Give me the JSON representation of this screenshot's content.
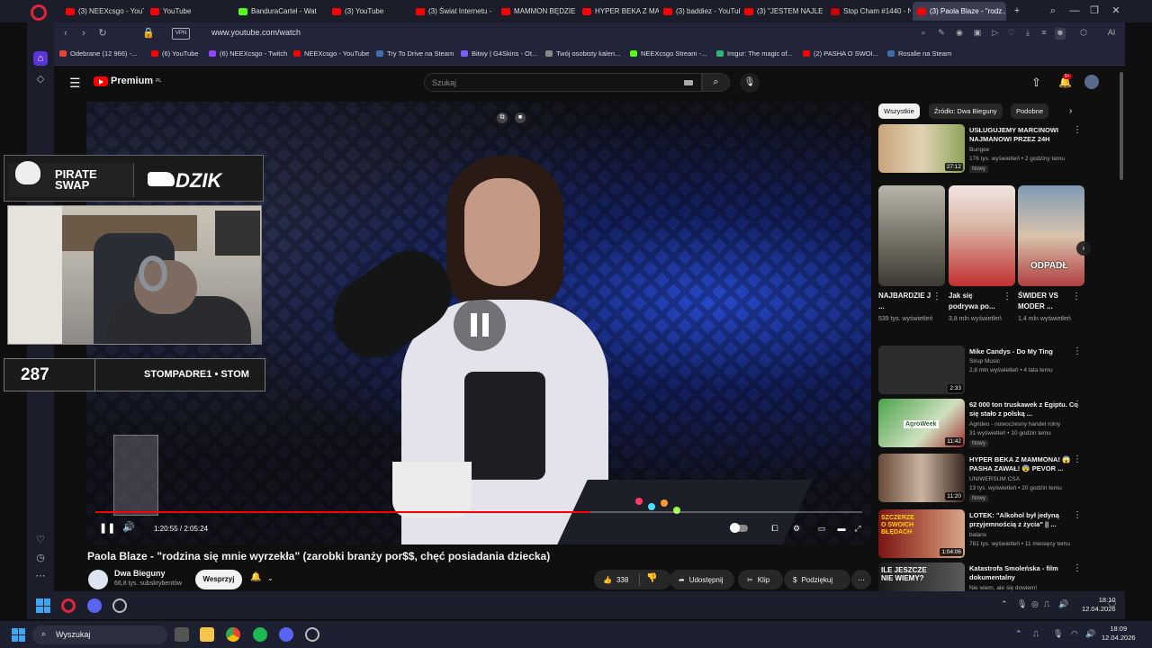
{
  "browser": {
    "tabs": [
      {
        "label": "(3) NEEXcsgo - YouTube",
        "icon": "youtube"
      },
      {
        "label": "YouTube",
        "icon": "youtube"
      },
      {
        "label": "BanduraCartel - Watch",
        "icon": "kick"
      },
      {
        "label": "(3) YouTube",
        "icon": "youtube"
      },
      {
        "label": "(3) Świat Internetu - YouTube",
        "icon": "youtube"
      },
      {
        "label": "MAMMON BĘDZIE O...",
        "icon": "youtube"
      },
      {
        "label": "HYPER BEKA Z MAMM...",
        "icon": "youtube"
      },
      {
        "label": "(3) baddiez - YouTube",
        "icon": "youtube"
      },
      {
        "label": "(3) \"JESTEM NAJLEPS...",
        "icon": "youtube"
      },
      {
        "label": "Stop Cham #1440 - N...",
        "icon": "youtube"
      },
      {
        "label": "(3) Paola Blaze - \"rodz...",
        "icon": "youtube",
        "active": true
      }
    ],
    "new_tab": "+",
    "vpn": "VPN",
    "url": "www.youtube.com/watch",
    "ai_label": "AI",
    "bookmarks": [
      {
        "label": "Odebrane (12 966) -..."
      },
      {
        "label": "(6) YouTube"
      },
      {
        "label": "(6) NEEXcsgo - Twitch"
      },
      {
        "label": "NEEXcsgo - YouTube"
      },
      {
        "label": "Try To Drive na Steam"
      },
      {
        "label": "Bitwy | G4Skins - Ot..."
      },
      {
        "label": "Twój osobisty kalen..."
      },
      {
        "label": "NEEXcsgo Stream -..."
      },
      {
        "label": "Imgur: The magic of..."
      },
      {
        "label": "(2) PASHA O SWOI..."
      },
      {
        "label": "Rosalie na Steam"
      }
    ]
  },
  "youtube": {
    "logo_text": "Premium",
    "logo_suffix": "PL",
    "search_placeholder": "Szukaj",
    "notification_count": "9+",
    "video": {
      "elapsed": "1:20:55",
      "duration": "2:05:24",
      "time_display": "1:20:55 / 2:05:24",
      "progress_fraction": 0.645,
      "title": "Paola Blaze - \"rodzina się mnie wyrzekła\" (zarobki branży por$$, chęć posiadania dziecka)"
    },
    "channel": {
      "name": "Dwa Bieguny",
      "subscribers": "66,8 tys. subskrybentów",
      "support_label": "Wesprzyj"
    },
    "actions": {
      "likes": "338",
      "share": "Udostępnij",
      "clip": "Klip",
      "thanks": "Podziękuj"
    },
    "chips": [
      "Wszystkie",
      "Źródło: Dwa Bieguny",
      "Podobne"
    ],
    "recommendations_top": [
      {
        "title": "USŁUGUJEMY MARCINOWI NAJMANOWI PRZEZ 24H",
        "channel": "Bungee",
        "meta": "176 tys. wyświetleń • 2 godziny temu",
        "badge": "Nowy",
        "duration": "27:12"
      }
    ],
    "shorts": [
      {
        "title": "NAJBARDZIE J ...",
        "views": "539 tys. wyświetleń"
      },
      {
        "title": "Jak się podrywa po...",
        "views": "3,8 mln wyświetleń"
      },
      {
        "title": "ŚWIDER VS MODER ...",
        "views": "1,4 mln wyświetleń",
        "overlay": "ODPADŁ"
      }
    ],
    "recommendations": [
      {
        "title": "Mike Candys - Do My Ting",
        "channel": "Sirup Music",
        "meta": "2,8 mln wyświetleń • 4 lata temu",
        "duration": "2:33",
        "badge": ""
      },
      {
        "title": "62 000 ton truskawek z Egiptu. Co się stało z polską ...",
        "channel": "Agrideo - nowoczesny handel rolny",
        "meta": "31 wyświetleń • 10 godzin temu",
        "duration": "11:42",
        "badge": "Nowy",
        "thumb_text": "AgroWeek"
      },
      {
        "title": "HYPER BEKA Z MAMMONA! 😱 PASHA ZAWAŁ! 😨 PEVOR ...",
        "channel": "UNIWERSUM CSA",
        "meta": "13 tys. wyświetleń • 20 godzin temu",
        "duration": "11:20",
        "badge": "Nowy"
      },
      {
        "title": "LOTEK: \"Alkohol był jedyną przyjemnością z życia\" || ...",
        "channel": "balans",
        "meta": "781 tys. wyświetleń • 11 miesięcy temu",
        "duration": "1:04:06",
        "badge": "",
        "thumb_text": "SZCZERZE O SWOICH BŁĘDACH"
      },
      {
        "title": "Katastrofa Smoleńska - film dokumentalny",
        "channel": "Nie wiem, ale się dowiem!",
        "meta": "",
        "duration": "",
        "badge": "",
        "thumb_text": "ILE JESZCZE NIE WIEMY?"
      }
    ]
  },
  "overlay": {
    "sponsor1": "PIRATE SWAP",
    "sponsor2": "DZIK",
    "counter": "287",
    "handle": "STOMPADRE1 • STOM"
  },
  "taskbar_inner": {
    "time": "18:10",
    "date": "12.04.2026"
  },
  "taskbar_outer": {
    "search": "Wyszukaj",
    "time": "18:09",
    "date": "12.04.2026"
  },
  "colors": {
    "accent": "#ff0000",
    "opera": "#e0243a",
    "home": "#5c35d9"
  }
}
